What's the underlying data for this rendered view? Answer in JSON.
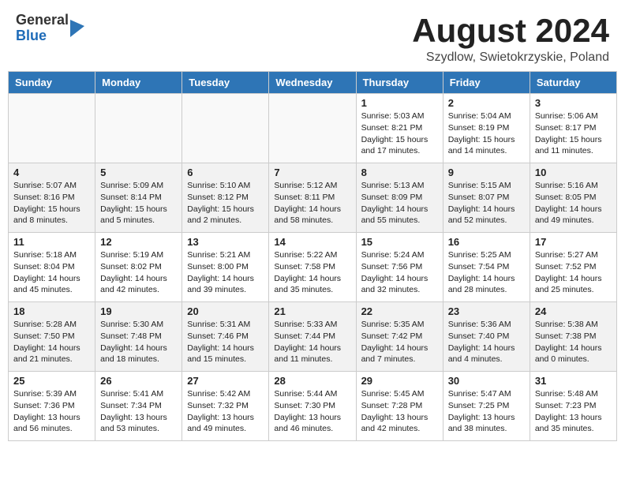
{
  "header": {
    "logo_general": "General",
    "logo_blue": "Blue",
    "title": "August 2024",
    "subtitle": "Szydlow, Swietokrzyskie, Poland"
  },
  "days_of_week": [
    "Sunday",
    "Monday",
    "Tuesday",
    "Wednesday",
    "Thursday",
    "Friday",
    "Saturday"
  ],
  "weeks": [
    [
      {
        "day": "",
        "info": ""
      },
      {
        "day": "",
        "info": ""
      },
      {
        "day": "",
        "info": ""
      },
      {
        "day": "",
        "info": ""
      },
      {
        "day": "1",
        "info": "Sunrise: 5:03 AM\nSunset: 8:21 PM\nDaylight: 15 hours\nand 17 minutes."
      },
      {
        "day": "2",
        "info": "Sunrise: 5:04 AM\nSunset: 8:19 PM\nDaylight: 15 hours\nand 14 minutes."
      },
      {
        "day": "3",
        "info": "Sunrise: 5:06 AM\nSunset: 8:17 PM\nDaylight: 15 hours\nand 11 minutes."
      }
    ],
    [
      {
        "day": "4",
        "info": "Sunrise: 5:07 AM\nSunset: 8:16 PM\nDaylight: 15 hours\nand 8 minutes."
      },
      {
        "day": "5",
        "info": "Sunrise: 5:09 AM\nSunset: 8:14 PM\nDaylight: 15 hours\nand 5 minutes."
      },
      {
        "day": "6",
        "info": "Sunrise: 5:10 AM\nSunset: 8:12 PM\nDaylight: 15 hours\nand 2 minutes."
      },
      {
        "day": "7",
        "info": "Sunrise: 5:12 AM\nSunset: 8:11 PM\nDaylight: 14 hours\nand 58 minutes."
      },
      {
        "day": "8",
        "info": "Sunrise: 5:13 AM\nSunset: 8:09 PM\nDaylight: 14 hours\nand 55 minutes."
      },
      {
        "day": "9",
        "info": "Sunrise: 5:15 AM\nSunset: 8:07 PM\nDaylight: 14 hours\nand 52 minutes."
      },
      {
        "day": "10",
        "info": "Sunrise: 5:16 AM\nSunset: 8:05 PM\nDaylight: 14 hours\nand 49 minutes."
      }
    ],
    [
      {
        "day": "11",
        "info": "Sunrise: 5:18 AM\nSunset: 8:04 PM\nDaylight: 14 hours\nand 45 minutes."
      },
      {
        "day": "12",
        "info": "Sunrise: 5:19 AM\nSunset: 8:02 PM\nDaylight: 14 hours\nand 42 minutes."
      },
      {
        "day": "13",
        "info": "Sunrise: 5:21 AM\nSunset: 8:00 PM\nDaylight: 14 hours\nand 39 minutes."
      },
      {
        "day": "14",
        "info": "Sunrise: 5:22 AM\nSunset: 7:58 PM\nDaylight: 14 hours\nand 35 minutes."
      },
      {
        "day": "15",
        "info": "Sunrise: 5:24 AM\nSunset: 7:56 PM\nDaylight: 14 hours\nand 32 minutes."
      },
      {
        "day": "16",
        "info": "Sunrise: 5:25 AM\nSunset: 7:54 PM\nDaylight: 14 hours\nand 28 minutes."
      },
      {
        "day": "17",
        "info": "Sunrise: 5:27 AM\nSunset: 7:52 PM\nDaylight: 14 hours\nand 25 minutes."
      }
    ],
    [
      {
        "day": "18",
        "info": "Sunrise: 5:28 AM\nSunset: 7:50 PM\nDaylight: 14 hours\nand 21 minutes."
      },
      {
        "day": "19",
        "info": "Sunrise: 5:30 AM\nSunset: 7:48 PM\nDaylight: 14 hours\nand 18 minutes."
      },
      {
        "day": "20",
        "info": "Sunrise: 5:31 AM\nSunset: 7:46 PM\nDaylight: 14 hours\nand 15 minutes."
      },
      {
        "day": "21",
        "info": "Sunrise: 5:33 AM\nSunset: 7:44 PM\nDaylight: 14 hours\nand 11 minutes."
      },
      {
        "day": "22",
        "info": "Sunrise: 5:35 AM\nSunset: 7:42 PM\nDaylight: 14 hours\nand 7 minutes."
      },
      {
        "day": "23",
        "info": "Sunrise: 5:36 AM\nSunset: 7:40 PM\nDaylight: 14 hours\nand 4 minutes."
      },
      {
        "day": "24",
        "info": "Sunrise: 5:38 AM\nSunset: 7:38 PM\nDaylight: 14 hours\nand 0 minutes."
      }
    ],
    [
      {
        "day": "25",
        "info": "Sunrise: 5:39 AM\nSunset: 7:36 PM\nDaylight: 13 hours\nand 56 minutes."
      },
      {
        "day": "26",
        "info": "Sunrise: 5:41 AM\nSunset: 7:34 PM\nDaylight: 13 hours\nand 53 minutes."
      },
      {
        "day": "27",
        "info": "Sunrise: 5:42 AM\nSunset: 7:32 PM\nDaylight: 13 hours\nand 49 minutes."
      },
      {
        "day": "28",
        "info": "Sunrise: 5:44 AM\nSunset: 7:30 PM\nDaylight: 13 hours\nand 46 minutes."
      },
      {
        "day": "29",
        "info": "Sunrise: 5:45 AM\nSunset: 7:28 PM\nDaylight: 13 hours\nand 42 minutes."
      },
      {
        "day": "30",
        "info": "Sunrise: 5:47 AM\nSunset: 7:25 PM\nDaylight: 13 hours\nand 38 minutes."
      },
      {
        "day": "31",
        "info": "Sunrise: 5:48 AM\nSunset: 7:23 PM\nDaylight: 13 hours\nand 35 minutes."
      }
    ]
  ]
}
